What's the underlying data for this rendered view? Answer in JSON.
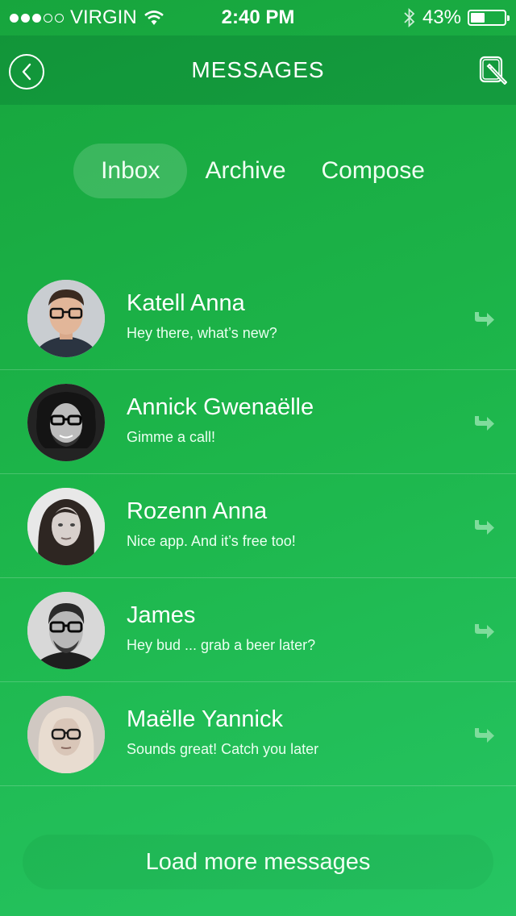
{
  "status_bar": {
    "carrier": "VIRGIN",
    "signal_full": 3,
    "signal_empty": 2,
    "time": "2:40 PM",
    "battery": "43%",
    "battery_level": 0.43
  },
  "header": {
    "title": "MESSAGES",
    "back_icon": "back-chevron-icon",
    "edit_icon": "edit-pencil-icon"
  },
  "tabs": [
    {
      "label": "Inbox",
      "active": true
    },
    {
      "label": "Archive",
      "active": false
    },
    {
      "label": "Compose",
      "active": false
    }
  ],
  "messages": [
    {
      "name": "Katell Anna",
      "preview": "Hey there, what’s new?"
    },
    {
      "name": "Annick Gwenaëlle",
      "preview": "Gimme a call!"
    },
    {
      "name": "Rozenn Anna",
      "preview": "Nice app. And it’s free too!"
    },
    {
      "name": "James",
      "preview": "Hey bud ... grab a beer later?"
    },
    {
      "name": "Maëlle Yannick",
      "preview": "Sounds great! Catch you later"
    }
  ],
  "load_more_label": "Load more messages",
  "colors": {
    "background_start": "#17a53d",
    "background_end": "#26c563",
    "text": "#ffffff"
  }
}
